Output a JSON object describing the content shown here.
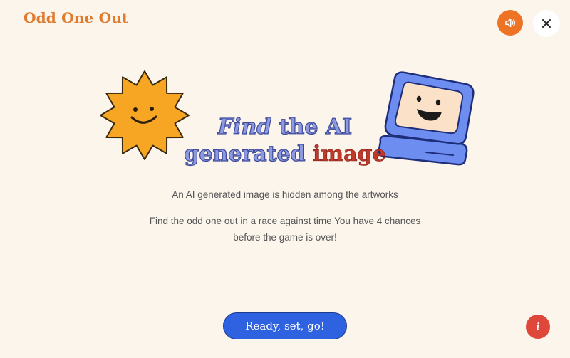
{
  "header": {
    "logo_text": "Odd One Out",
    "sound_icon": "speaker-icon",
    "close_icon": "close-icon",
    "close_glyph": "✕"
  },
  "hero": {
    "title_line1_a": "Find",
    "title_line1_b": " the AI",
    "title_line2_a": "generated ",
    "title_line2_b": "image"
  },
  "body": {
    "line1": "An AI generated image is hidden among the artworks",
    "line2": "Find the odd one out in a race against time You have 4 chances before the game is over!"
  },
  "footer": {
    "start_label": "Ready, set, go!",
    "info_glyph": "i",
    "info_icon": "info-icon"
  },
  "colors": {
    "background": "#fbf5ec",
    "brand_orange": "#ec7424",
    "primary_blue": "#2f62e0",
    "title_blue": "#8e9ae0",
    "title_red": "#c0392b",
    "info_red": "#e0473b",
    "sun_yellow": "#f6a623",
    "computer_blue": "#6d8ef0"
  },
  "illustrations": {
    "sun": "smiling-sun-illustration",
    "computer": "smiling-computer-illustration"
  }
}
